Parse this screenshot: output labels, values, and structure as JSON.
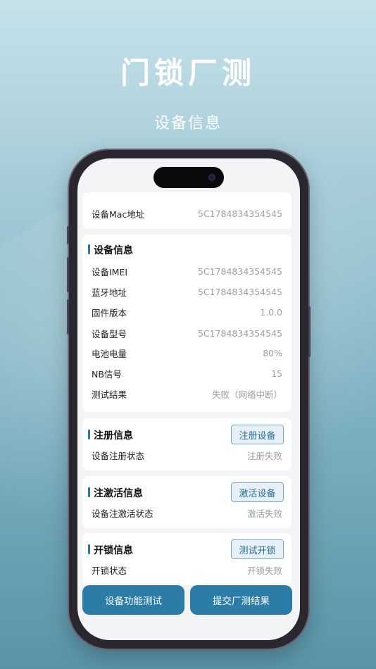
{
  "hero": {
    "title": "门锁厂测",
    "subtitle": "设备信息"
  },
  "mac": {
    "label": "设备Mac地址",
    "value": "5C1784834354545"
  },
  "device_info": {
    "title": "设备信息",
    "rows": [
      {
        "label": "设备IMEI",
        "value": "5C1784834354545"
      },
      {
        "label": "蓝牙地址",
        "value": "5C1784834354545"
      },
      {
        "label": "固件版本",
        "value": "1.0.0"
      },
      {
        "label": "设备型号",
        "value": "5C1784834354545"
      },
      {
        "label": "电池电量",
        "value": "80%"
      },
      {
        "label": "NB信号",
        "value": "15"
      },
      {
        "label": "测试结果",
        "value": "失败（网络中断）"
      }
    ]
  },
  "register": {
    "title": "注册信息",
    "button": "注册设备",
    "status_label": "设备注册状态",
    "status_value": "注册失败"
  },
  "activate": {
    "title": "注激活信息",
    "button": "激活设备",
    "status_label": "设备注激活状态",
    "status_value": "激活失败"
  },
  "unlock": {
    "title": "开锁信息",
    "button": "测试开锁",
    "status_label": "开锁状态",
    "status_value": "开锁失败"
  },
  "footer": {
    "left_button": "设备功能测试",
    "right_button": "提交厂测结果"
  },
  "colors": {
    "accent": "#2b7da8",
    "outline_btn_text": "#2a6d96"
  }
}
